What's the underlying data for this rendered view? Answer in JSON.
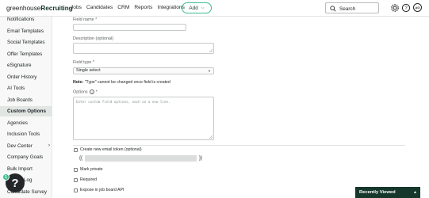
{
  "app": {
    "logo_main": "greenhouse",
    "logo_accent": "Recruiting"
  },
  "nav": {
    "items": [
      "Jobs",
      "Candidates",
      "CRM",
      "Reports",
      "Integrations"
    ],
    "add_label": "Add",
    "search_placeholder": "Search",
    "avatar_initials": "AG"
  },
  "sidebar": {
    "items": [
      {
        "label": "Notifications"
      },
      {
        "label": "Email Templates"
      },
      {
        "label": "Social Templates"
      },
      {
        "label": "Offer Templates"
      },
      {
        "label": "eSignature"
      },
      {
        "label": "Order History"
      },
      {
        "label": "AI Tools"
      },
      {
        "label": "Job Boards"
      },
      {
        "label": "Custom Options"
      },
      {
        "label": "Agencies"
      },
      {
        "label": "Inclusion Tools"
      },
      {
        "label": "Dev Center"
      },
      {
        "label": "Company Goals"
      },
      {
        "label": "Bulk Import"
      },
      {
        "label": "Log"
      },
      {
        "label": "Candidate Survey"
      }
    ],
    "active_label": "Custom Options",
    "help_icon": "?",
    "help_badge": "1"
  },
  "form": {
    "field_name_label": "Field name",
    "description_label": "Description (optional)",
    "field_type_label": "Field type",
    "required_marker": "*",
    "field_type_value": "Single select",
    "note_bold": "Note:",
    "note_text": "\"Type\" cannot be changed once field is created",
    "options_label": "Options",
    "options_placeholder": "Enter custom field options, each on a new line.",
    "email_token_label": "Create new email token (optional)",
    "token_open": "{{",
    "token_close": "}}",
    "mark_private_label": "Mark private",
    "required_label": "Required",
    "expose_label": "Expose in job board API"
  },
  "recent": {
    "label": "Recently Viewed"
  }
}
